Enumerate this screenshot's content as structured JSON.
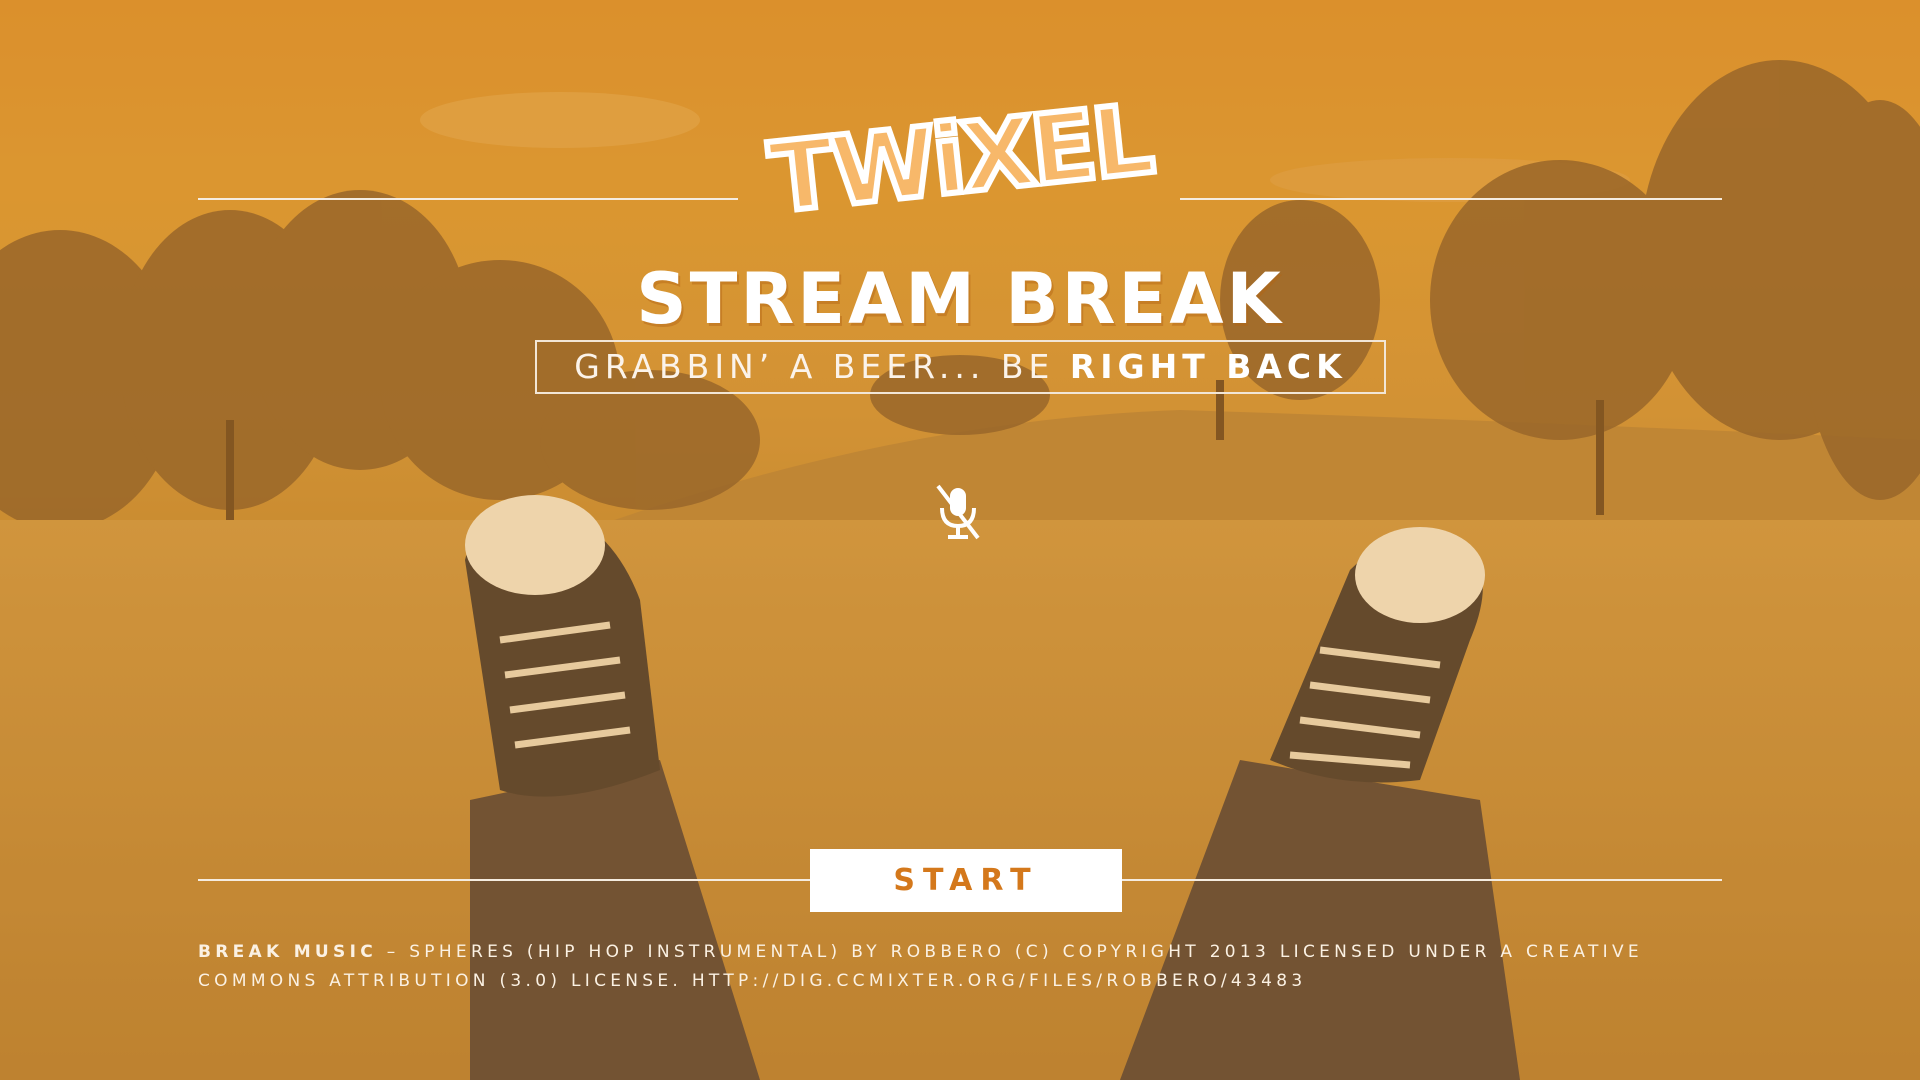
{
  "logo_text": "TWiXEL",
  "title": "STREAM BREAK",
  "subtitle": {
    "prefix": "GRABBIN’ A BEER... BE ",
    "emphasis": "RIGHT BACK"
  },
  "mic_status_icon": "microphone-muted-icon",
  "start_button_label": "START",
  "credits": {
    "label": "BREAK MUSIC",
    "text": " – SPHERES (HIP HOP INSTRUMENTAL) BY ROBBERO (C) COPYRIGHT 2013 LICENSED UNDER A CREATIVE COMMONS ATTRIBUTION (3.0) LICENSE. HTTP://DIG.CCMIXTER.ORG/FILES/ROBBERO/43483"
  },
  "colors": {
    "accent": "#d4781b",
    "tint": "#d99733",
    "text": "#ffffff"
  }
}
